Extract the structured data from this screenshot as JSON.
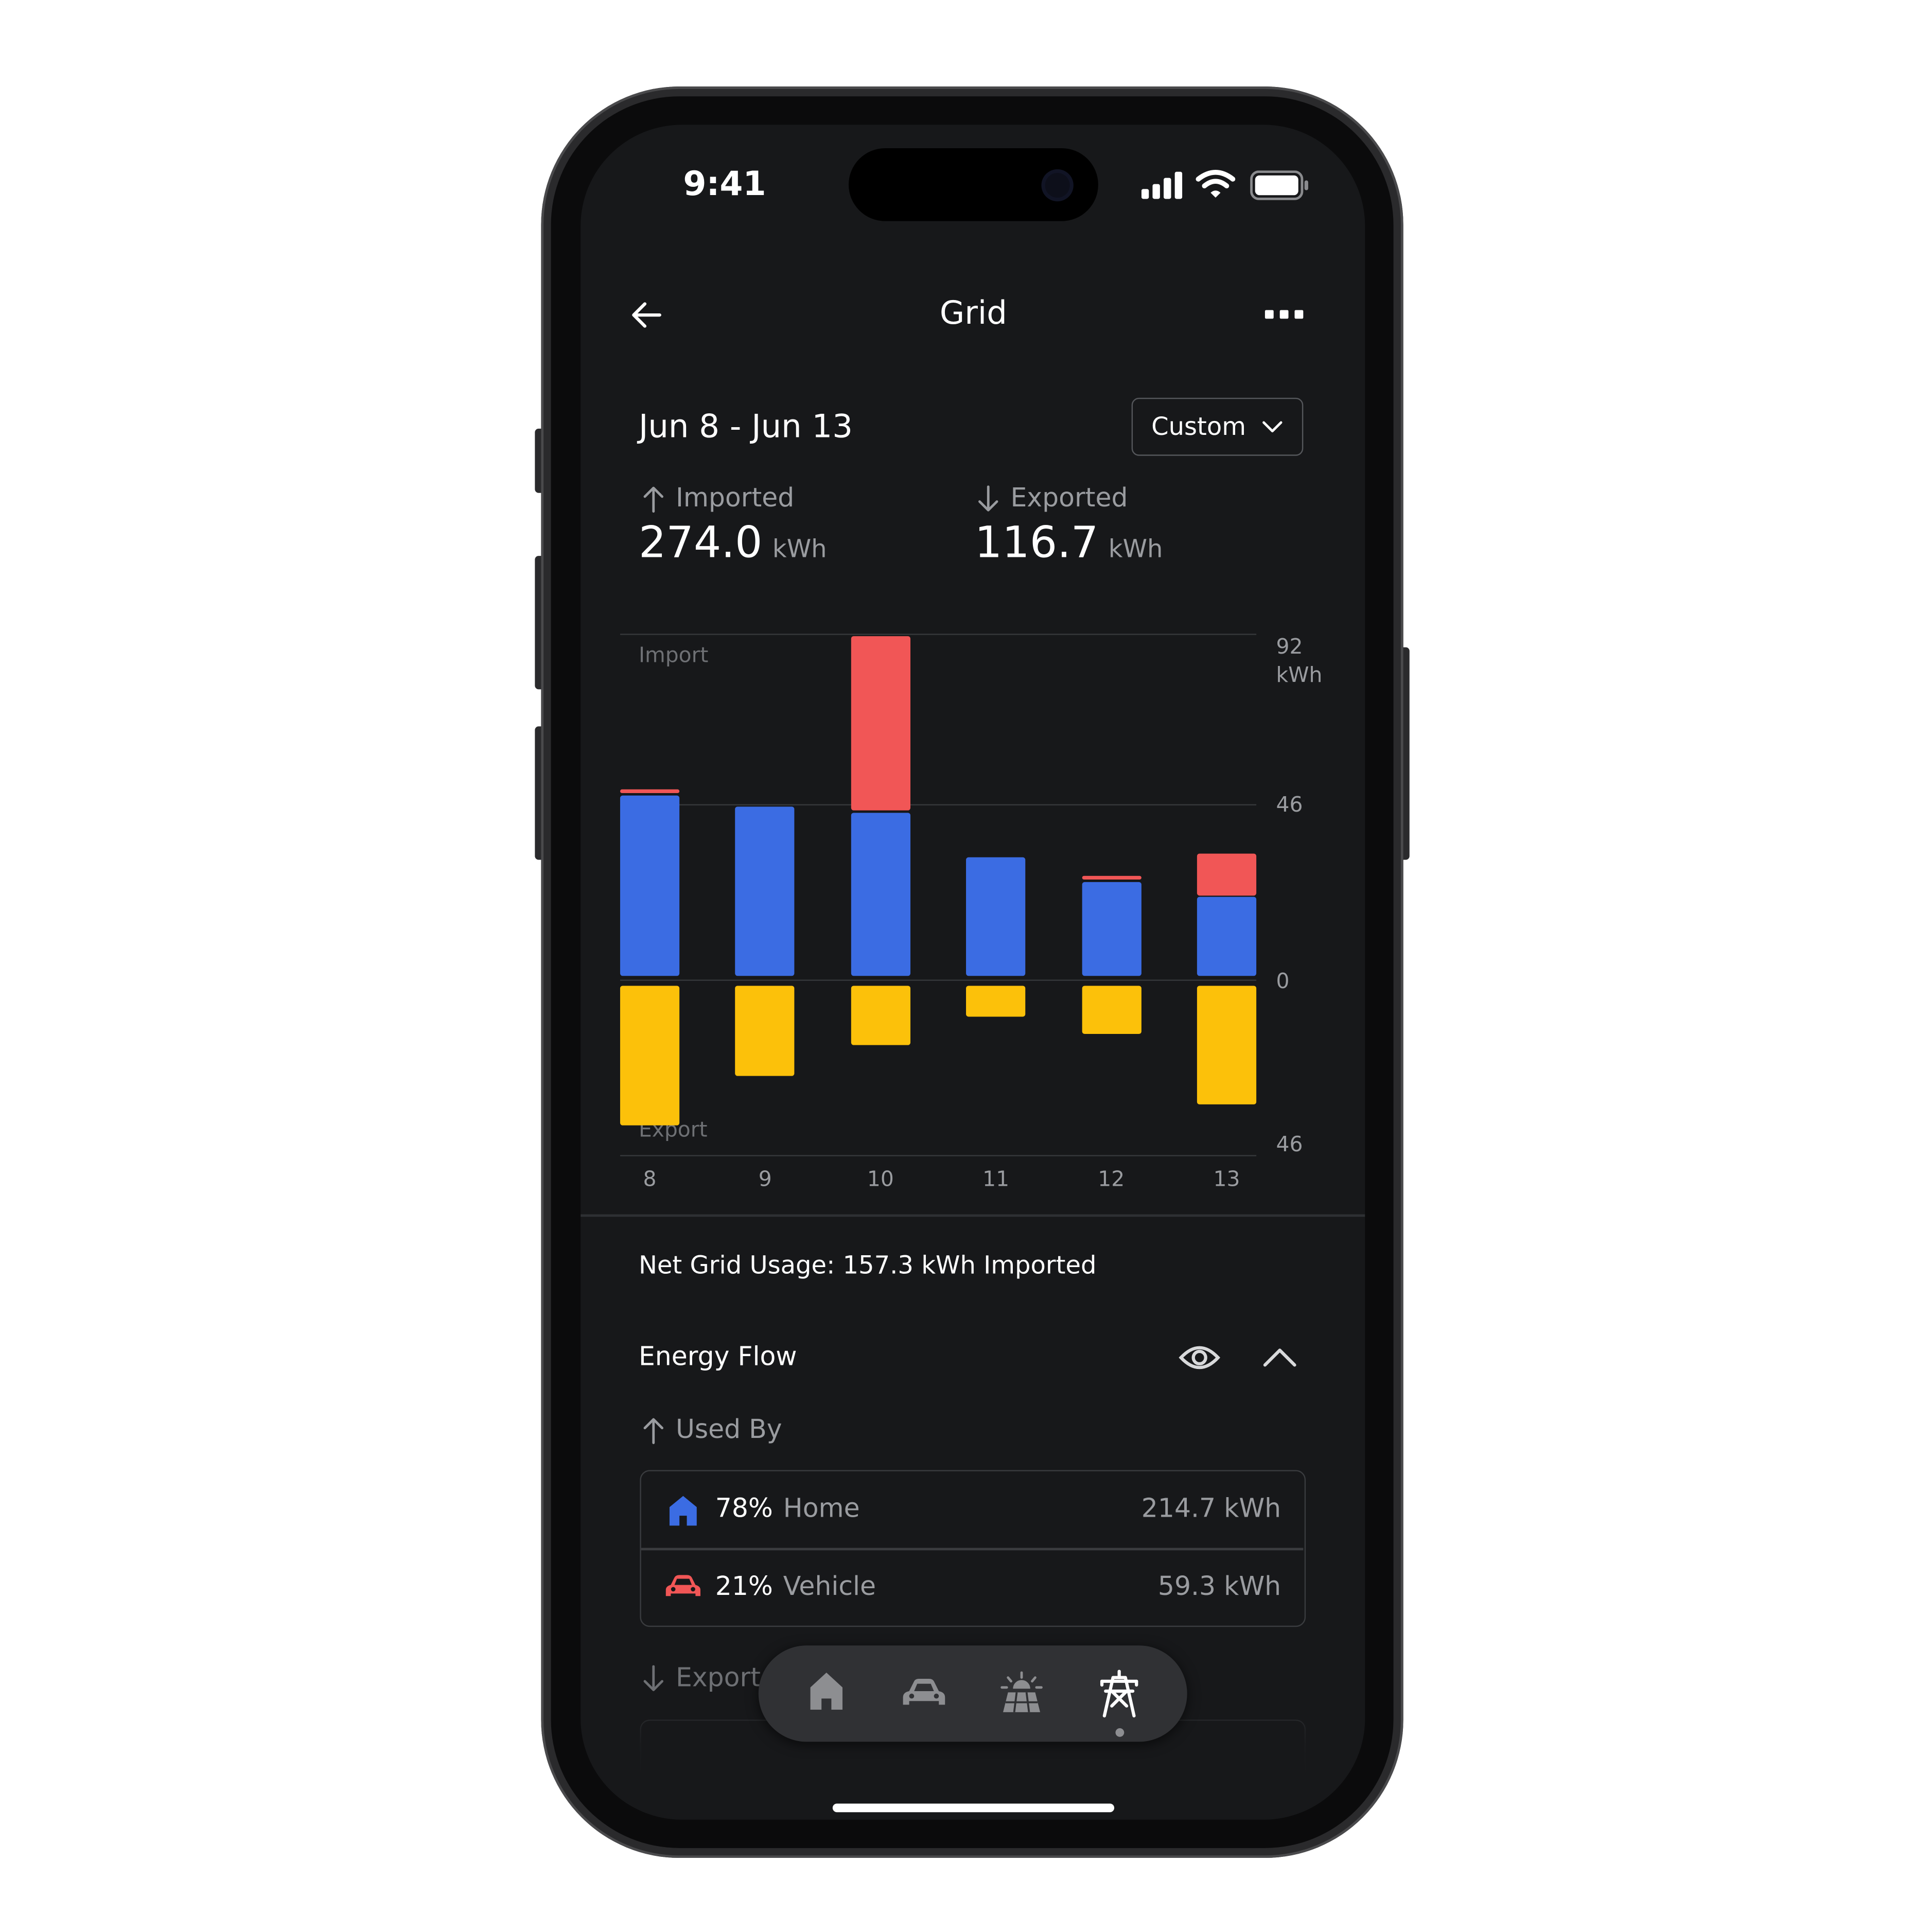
{
  "status_bar": {
    "time": "9:41"
  },
  "header": {
    "title": "Grid"
  },
  "date_range": {
    "label": "Jun 8 - Jun 13",
    "period_button": "Custom"
  },
  "summary": {
    "imported": {
      "label": "Imported",
      "value": "274.0",
      "unit": "kWh"
    },
    "exported": {
      "label": "Exported",
      "value": "116.7",
      "unit": "kWh"
    }
  },
  "chart_data": {
    "type": "bar",
    "categories": [
      "8",
      "9",
      "10",
      "11",
      "12",
      "13"
    ],
    "import_label": "Import",
    "export_label": "Export",
    "y_ticks": {
      "top": "92",
      "unit": "kWh",
      "mid": "46",
      "zero": "0",
      "export_max": "46"
    },
    "ylim_import": [
      0,
      92
    ],
    "ylim_export": [
      0,
      46
    ],
    "series": [
      {
        "key": "home",
        "stack": "import",
        "values": [
          48,
          45,
          43.5,
          31.5,
          25,
          21
        ]
      },
      {
        "key": "vehicle",
        "stack": "import",
        "values": [
          1.2,
          0,
          46.5,
          0,
          1.2,
          11
        ]
      },
      {
        "key": "solar",
        "stack": "export",
        "values": [
          36.5,
          23.5,
          15.5,
          8,
          12.5,
          31
        ]
      }
    ],
    "colors": {
      "home": "#3b6ce3",
      "vehicle": "#f15656",
      "solar": "#fcc10a"
    }
  },
  "net_usage": {
    "text": "Net Grid Usage: 157.3 kWh Imported"
  },
  "energy_flow": {
    "title": "Energy Flow",
    "used_by_label": "Used By",
    "used_by": [
      {
        "percent": "78%",
        "name": "Home",
        "value": "214.7 kWh",
        "icon": "home-icon"
      },
      {
        "percent": "21%",
        "name": "Vehicle",
        "value": "59.3 kWh",
        "icon": "car-icon"
      }
    ],
    "export_label": "Export"
  },
  "dock": {
    "items": [
      "home-icon",
      "car-icon",
      "solar-icon",
      "grid-tower-icon"
    ],
    "active": 3
  }
}
